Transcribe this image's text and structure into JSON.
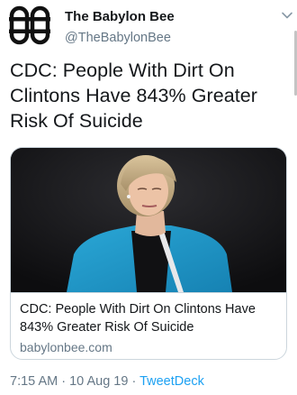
{
  "author": {
    "display_name": "The Babylon Bee",
    "handle": "@TheBabylonBee"
  },
  "tweet": {
    "text": "CDC: People With Dirt On Clintons Have 843% Greater Risk Of Suicide"
  },
  "card": {
    "title": "CDC: People With Dirt On Clintons Have 843% Greater Risk Of Suicide",
    "domain": "babylonbee.com"
  },
  "meta": {
    "time": "7:15 AM",
    "separator": "·",
    "date": "10 Aug 19",
    "source": "TweetDeck"
  },
  "icons": {
    "avatar": "babylon-bee-logo",
    "menu": "chevron-down-icon"
  },
  "colors": {
    "text": "#14171a",
    "secondary": "#657786",
    "link": "#1da1f2",
    "border": "#ccd6dd",
    "logo": "#111111"
  }
}
